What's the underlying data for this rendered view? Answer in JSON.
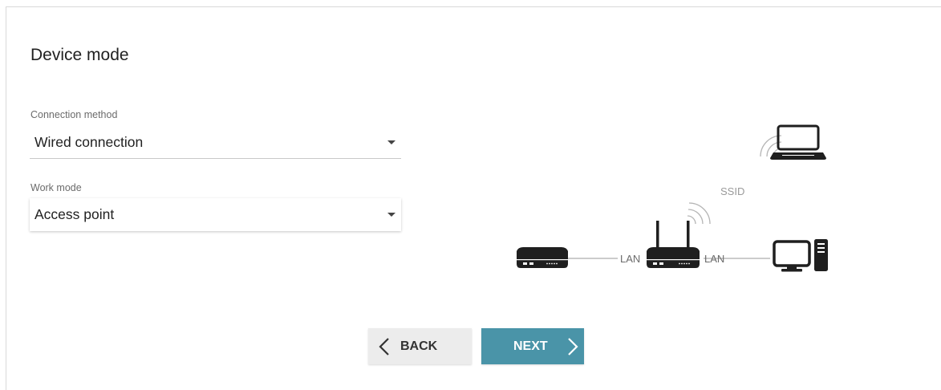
{
  "page": {
    "title": "Device mode"
  },
  "connection": {
    "label": "Connection method",
    "value": "Wired connection"
  },
  "work_mode": {
    "label": "Work mode",
    "value": "Access point"
  },
  "diagram": {
    "ssid_label": "SSID",
    "lan_left": "LAN",
    "lan_right": "LAN"
  },
  "buttons": {
    "back": "BACK",
    "next": "NEXT"
  },
  "colors": {
    "accent": "#4a94a8",
    "icon": "#1f1f1f"
  },
  "icons": {
    "back": "chevron-left-icon",
    "next": "chevron-right-icon"
  }
}
